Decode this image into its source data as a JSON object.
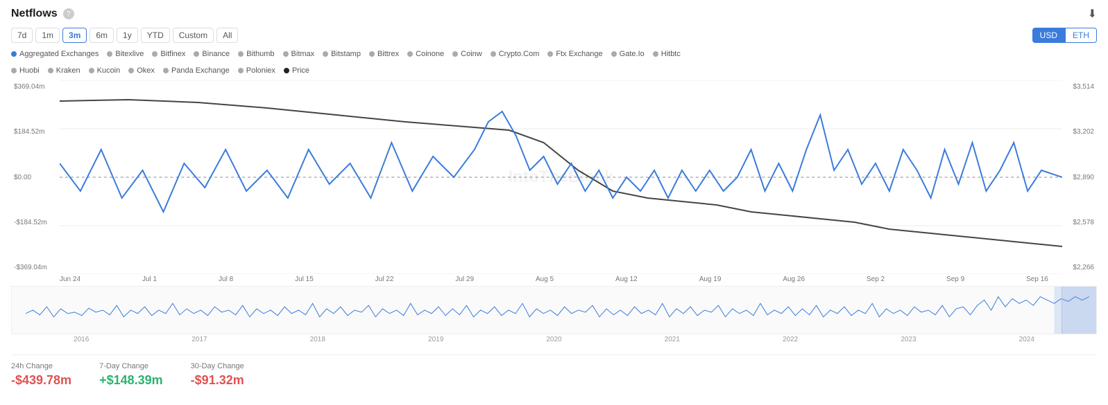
{
  "header": {
    "title": "Netflows",
    "download_label": "⬇"
  },
  "time_buttons": [
    {
      "label": "7d",
      "active": false
    },
    {
      "label": "1m",
      "active": false
    },
    {
      "label": "3m",
      "active": true
    },
    {
      "label": "6m",
      "active": false
    },
    {
      "label": "1y",
      "active": false
    },
    {
      "label": "YTD",
      "active": false
    },
    {
      "label": "Custom",
      "active": false
    },
    {
      "label": "All",
      "active": false
    }
  ],
  "currency_buttons": [
    {
      "label": "USD",
      "active": true
    },
    {
      "label": "ETH",
      "active": false
    }
  ],
  "legend": [
    {
      "label": "Aggregated Exchanges",
      "type": "blue"
    },
    {
      "label": "Bitexlive",
      "type": "gray"
    },
    {
      "label": "Bitfinex",
      "type": "gray"
    },
    {
      "label": "Binance",
      "type": "gray"
    },
    {
      "label": "Bithumb",
      "type": "gray"
    },
    {
      "label": "Bitmax",
      "type": "gray"
    },
    {
      "label": "Bitstamp",
      "type": "gray"
    },
    {
      "label": "Bittrex",
      "type": "gray"
    },
    {
      "label": "Coinone",
      "type": "gray"
    },
    {
      "label": "Coinw",
      "type": "gray"
    },
    {
      "label": "Crypto.Com",
      "type": "gray"
    },
    {
      "label": "Ftx Exchange",
      "type": "gray"
    },
    {
      "label": "Gate.Io",
      "type": "gray"
    },
    {
      "label": "Hitbtc",
      "type": "gray"
    },
    {
      "label": "Huobi",
      "type": "gray"
    },
    {
      "label": "Kraken",
      "type": "gray"
    },
    {
      "label": "Kucoin",
      "type": "gray"
    },
    {
      "label": "Okex",
      "type": "gray"
    },
    {
      "label": "Panda Exchange",
      "type": "gray"
    },
    {
      "label": "Poloniex",
      "type": "gray"
    },
    {
      "label": "Price",
      "type": "dark"
    }
  ],
  "y_axis": {
    "labels": [
      "$369.04m",
      "$184.52m",
      "$0.00",
      "-$184.52m",
      "-$369.04m"
    ]
  },
  "y_axis_right": {
    "labels": [
      "$3,514",
      "$3,202",
      "$2,890",
      "$2,578",
      "$2,266"
    ]
  },
  "x_axis": {
    "labels": [
      "Jun 24",
      "Jul 1",
      "Jul 8",
      "Jul 15",
      "Jul 22",
      "Jul 29",
      "Aug 5",
      "Aug 12",
      "Aug 19",
      "Aug 26",
      "Sep 2",
      "Sep 9",
      "Sep 16"
    ]
  },
  "mini_chart": {
    "year_labels": [
      "2016",
      "2017",
      "2018",
      "2019",
      "2020",
      "2021",
      "2022",
      "2023",
      "2024"
    ]
  },
  "stats": [
    {
      "label": "24h Change",
      "value": "-$439.78m",
      "type": "negative"
    },
    {
      "label": "7-Day Change",
      "value": "+$148.39m",
      "type": "positive"
    },
    {
      "label": "30-Day Change",
      "value": "-$91.32m",
      "type": "negative"
    }
  ],
  "watermark": "IntoTheBlock"
}
